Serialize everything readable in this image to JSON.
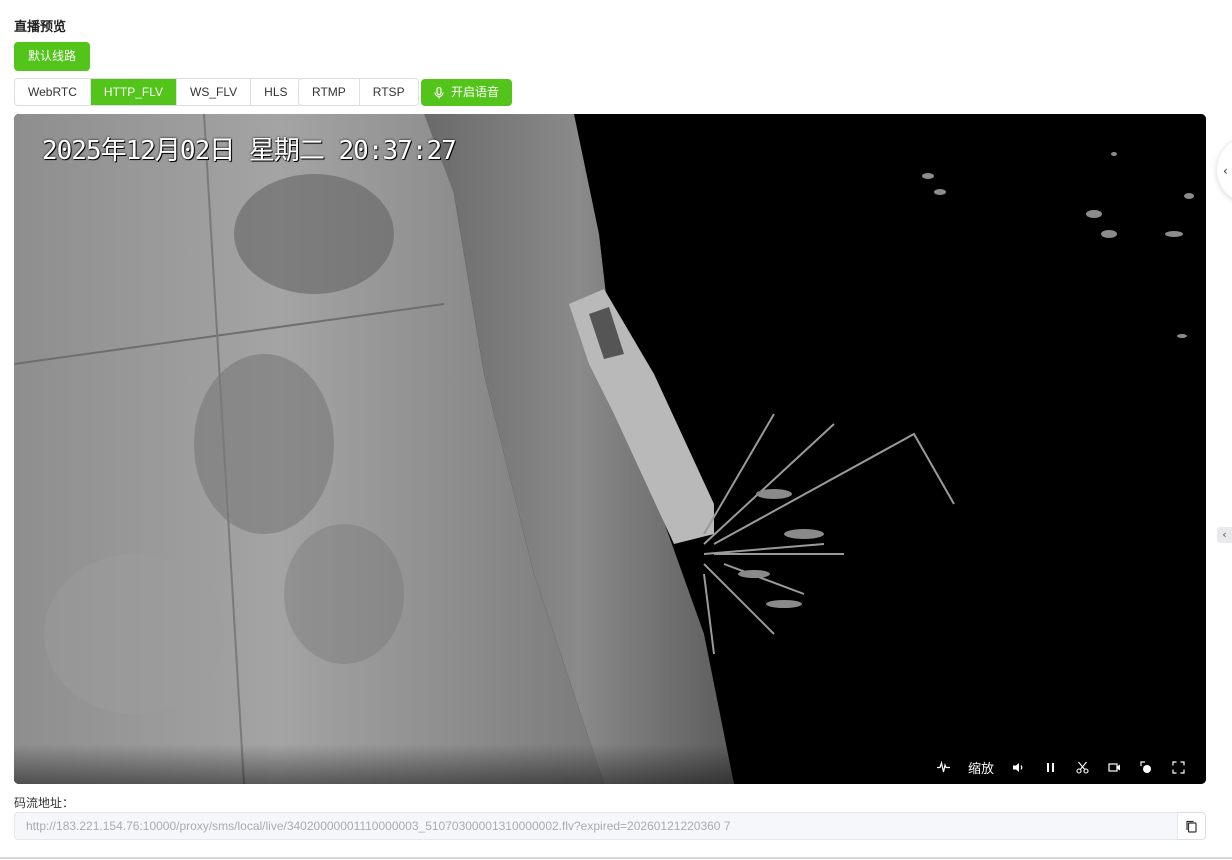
{
  "header": {
    "title": "直播预览"
  },
  "line": {
    "label": "默认线路"
  },
  "protocols": {
    "group_a": [
      "WebRTC",
      "HTTP_FLV",
      "WS_FLV",
      "HLS"
    ],
    "group_b": [
      "RTMP",
      "RTSP"
    ],
    "active": "HTTP_FLV"
  },
  "voice": {
    "label": "开启语音",
    "icon": "microphone-icon"
  },
  "player": {
    "osd_timestamp": "2025年12月02日 星期二 20:37:27",
    "controls": {
      "zoom_label": "缩放",
      "icons": [
        "waveform-icon",
        "volume-icon",
        "pause-icon",
        "scissors-icon",
        "record-icon",
        "screenshot-icon",
        "fullscreen-icon"
      ]
    }
  },
  "stream": {
    "label": "码流地址：",
    "url": "http://183.221.154.76:10000/proxy/sms/local/live/34020000001110000003_51070300001310000002.flv?expired=20260121220360 7"
  },
  "colors": {
    "accent": "#52c41a",
    "border": "#dcdfe6"
  }
}
